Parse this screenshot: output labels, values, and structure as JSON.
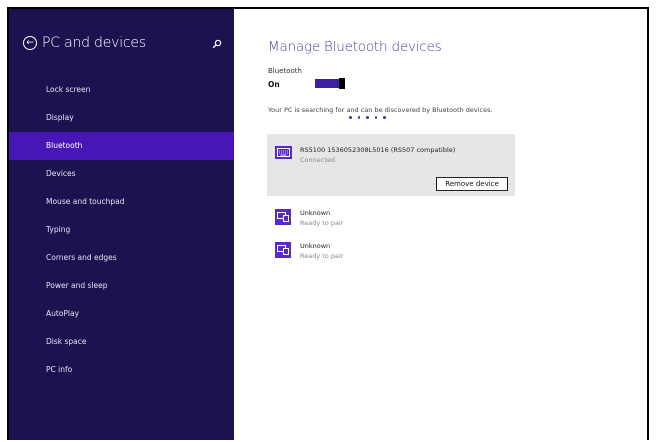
{
  "sidebar": {
    "title": "PC and devices",
    "items": [
      {
        "label": "Lock screen"
      },
      {
        "label": "Display"
      },
      {
        "label": "Bluetooth",
        "active": true
      },
      {
        "label": "Devices"
      },
      {
        "label": "Mouse and touchpad"
      },
      {
        "label": "Typing"
      },
      {
        "label": "Corners and edges"
      },
      {
        "label": "Power and sleep"
      },
      {
        "label": "AutoPlay"
      },
      {
        "label": "Disk space"
      },
      {
        "label": "PC info"
      }
    ]
  },
  "main": {
    "title": "Manage Bluetooth devices",
    "bluetooth_label": "Bluetooth",
    "bluetooth_state": "On",
    "searching_text": "Your PC is searching for and can be discovered by Bluetooth devices.",
    "devices": [
      {
        "name": "RS5100 1536052308L5016 (RS507 compatible)",
        "status": "Connected",
        "action": "Remove device"
      },
      {
        "name": "Unknown",
        "status": "Ready to pair"
      },
      {
        "name": "Unknown",
        "status": "Ready to pair"
      }
    ]
  },
  "colors": {
    "sidebar_bg": "#1c1250",
    "accent": "#4617b4",
    "title": "#4a3d9a"
  }
}
